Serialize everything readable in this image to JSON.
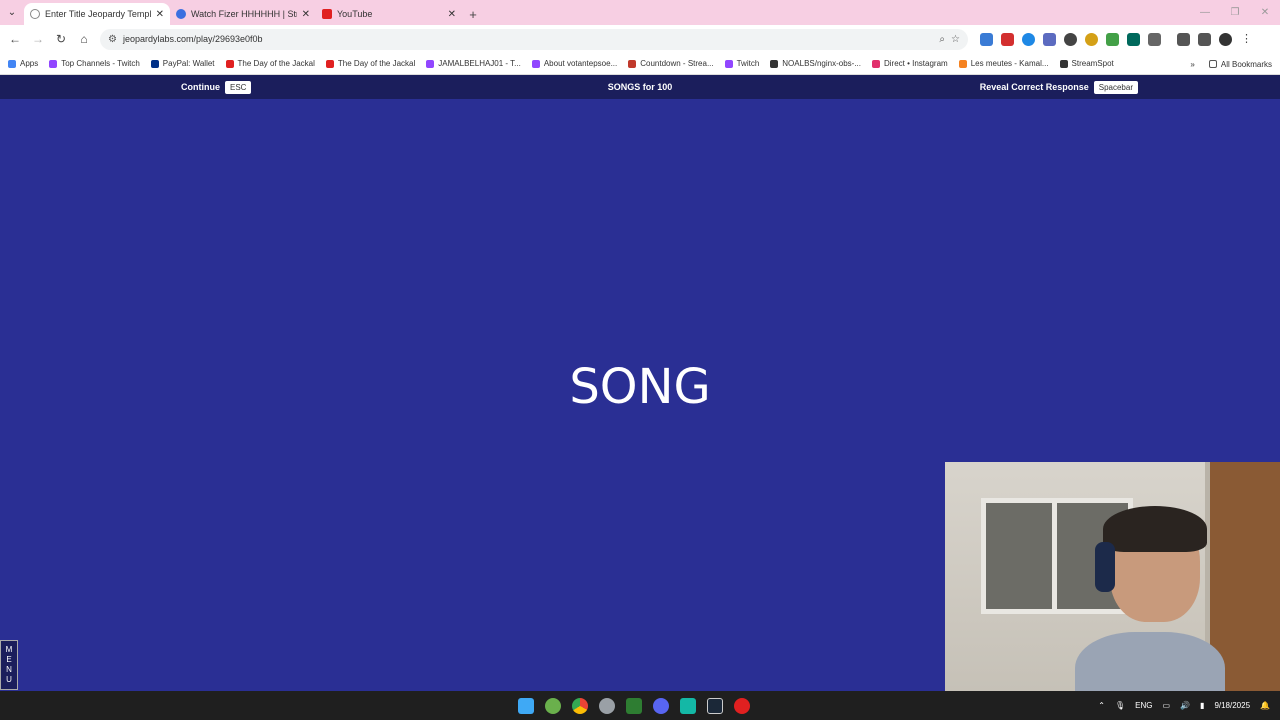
{
  "browser": {
    "tabs": [
      {
        "title": "Enter Title Jeopardy Template",
        "active": true,
        "favicon_color": "#888888"
      },
      {
        "title": "Watch Fizer HHHHHH | Streams",
        "active": false,
        "favicon_color": "#3b6fe0"
      },
      {
        "title": "YouTube",
        "active": false,
        "favicon_color": "#e02020"
      }
    ],
    "url": "jeopardylabs.com/play/29693e0f0b",
    "bookmarks": [
      {
        "label": "Apps",
        "color": "#4285f4"
      },
      {
        "label": "Top Channels - Twitch",
        "color": "#9146ff"
      },
      {
        "label": "PayPal: Wallet",
        "color": "#003087"
      },
      {
        "label": "The Day of the Jackal",
        "color": "#e02020"
      },
      {
        "label": "The Day of the Jackal",
        "color": "#e02020"
      },
      {
        "label": "JAMALBELHAJ01 - T...",
        "color": "#9146ff"
      },
      {
        "label": "About votantepsoe...",
        "color": "#9146ff"
      },
      {
        "label": "Countdown - Strea...",
        "color": "#c0392b"
      },
      {
        "label": "Twitch",
        "color": "#9146ff"
      },
      {
        "label": "NOALBS/nginx-obs-...",
        "color": "#333333"
      },
      {
        "label": "Direct • Instagram",
        "color": "#e1306c"
      },
      {
        "label": "Les meutes - Kamal...",
        "color": "#f58220"
      },
      {
        "label": "StreamSpot",
        "color": "#333333"
      }
    ],
    "all_bookmarks": "All Bookmarks"
  },
  "jeopardy": {
    "continue_label": "Continue",
    "continue_key": "ESC",
    "category_title": "SONGS for 100",
    "reveal_label": "Reveal Correct Response",
    "reveal_key": "Spacebar",
    "clue": "SONG",
    "menu_letters": [
      "M",
      "E",
      "N",
      "U"
    ]
  },
  "taskbar": {
    "lang": "ENG",
    "date": "9/18/2025"
  },
  "colors": {
    "board_bg": "#2a2f94",
    "bar_bg": "#1b1e5c",
    "tabstrip_bg": "#f7cfe3"
  }
}
